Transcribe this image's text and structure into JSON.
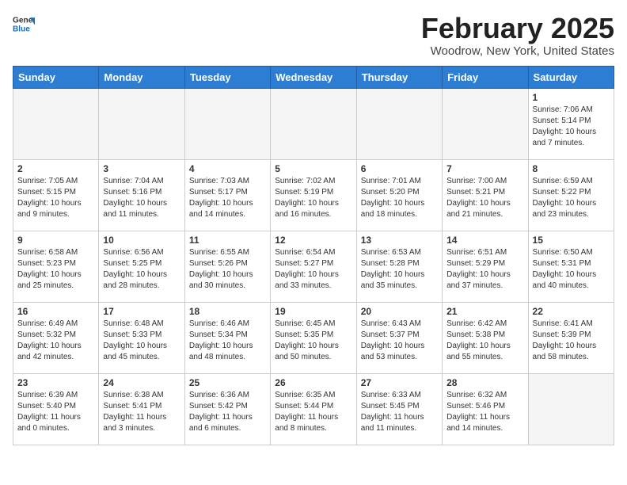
{
  "header": {
    "logo_general": "General",
    "logo_blue": "Blue",
    "title": "February 2025",
    "subtitle": "Woodrow, New York, United States"
  },
  "days_of_week": [
    "Sunday",
    "Monday",
    "Tuesday",
    "Wednesday",
    "Thursday",
    "Friday",
    "Saturday"
  ],
  "weeks": [
    [
      {
        "day": "",
        "empty": true
      },
      {
        "day": "",
        "empty": true
      },
      {
        "day": "",
        "empty": true
      },
      {
        "day": "",
        "empty": true
      },
      {
        "day": "",
        "empty": true
      },
      {
        "day": "",
        "empty": true
      },
      {
        "day": "1",
        "sunrise": "7:06 AM",
        "sunset": "5:14 PM",
        "daylight": "10 hours and 7 minutes."
      }
    ],
    [
      {
        "day": "2",
        "sunrise": "7:05 AM",
        "sunset": "5:15 PM",
        "daylight": "10 hours and 9 minutes."
      },
      {
        "day": "3",
        "sunrise": "7:04 AM",
        "sunset": "5:16 PM",
        "daylight": "10 hours and 11 minutes."
      },
      {
        "day": "4",
        "sunrise": "7:03 AM",
        "sunset": "5:17 PM",
        "daylight": "10 hours and 14 minutes."
      },
      {
        "day": "5",
        "sunrise": "7:02 AM",
        "sunset": "5:19 PM",
        "daylight": "10 hours and 16 minutes."
      },
      {
        "day": "6",
        "sunrise": "7:01 AM",
        "sunset": "5:20 PM",
        "daylight": "10 hours and 18 minutes."
      },
      {
        "day": "7",
        "sunrise": "7:00 AM",
        "sunset": "5:21 PM",
        "daylight": "10 hours and 21 minutes."
      },
      {
        "day": "8",
        "sunrise": "6:59 AM",
        "sunset": "5:22 PM",
        "daylight": "10 hours and 23 minutes."
      }
    ],
    [
      {
        "day": "9",
        "sunrise": "6:58 AM",
        "sunset": "5:23 PM",
        "daylight": "10 hours and 25 minutes."
      },
      {
        "day": "10",
        "sunrise": "6:56 AM",
        "sunset": "5:25 PM",
        "daylight": "10 hours and 28 minutes."
      },
      {
        "day": "11",
        "sunrise": "6:55 AM",
        "sunset": "5:26 PM",
        "daylight": "10 hours and 30 minutes."
      },
      {
        "day": "12",
        "sunrise": "6:54 AM",
        "sunset": "5:27 PM",
        "daylight": "10 hours and 33 minutes."
      },
      {
        "day": "13",
        "sunrise": "6:53 AM",
        "sunset": "5:28 PM",
        "daylight": "10 hours and 35 minutes."
      },
      {
        "day": "14",
        "sunrise": "6:51 AM",
        "sunset": "5:29 PM",
        "daylight": "10 hours and 37 minutes."
      },
      {
        "day": "15",
        "sunrise": "6:50 AM",
        "sunset": "5:31 PM",
        "daylight": "10 hours and 40 minutes."
      }
    ],
    [
      {
        "day": "16",
        "sunrise": "6:49 AM",
        "sunset": "5:32 PM",
        "daylight": "10 hours and 42 minutes."
      },
      {
        "day": "17",
        "sunrise": "6:48 AM",
        "sunset": "5:33 PM",
        "daylight": "10 hours and 45 minutes."
      },
      {
        "day": "18",
        "sunrise": "6:46 AM",
        "sunset": "5:34 PM",
        "daylight": "10 hours and 48 minutes."
      },
      {
        "day": "19",
        "sunrise": "6:45 AM",
        "sunset": "5:35 PM",
        "daylight": "10 hours and 50 minutes."
      },
      {
        "day": "20",
        "sunrise": "6:43 AM",
        "sunset": "5:37 PM",
        "daylight": "10 hours and 53 minutes."
      },
      {
        "day": "21",
        "sunrise": "6:42 AM",
        "sunset": "5:38 PM",
        "daylight": "10 hours and 55 minutes."
      },
      {
        "day": "22",
        "sunrise": "6:41 AM",
        "sunset": "5:39 PM",
        "daylight": "10 hours and 58 minutes."
      }
    ],
    [
      {
        "day": "23",
        "sunrise": "6:39 AM",
        "sunset": "5:40 PM",
        "daylight": "11 hours and 0 minutes."
      },
      {
        "day": "24",
        "sunrise": "6:38 AM",
        "sunset": "5:41 PM",
        "daylight": "11 hours and 3 minutes."
      },
      {
        "day": "25",
        "sunrise": "6:36 AM",
        "sunset": "5:42 PM",
        "daylight": "11 hours and 6 minutes."
      },
      {
        "day": "26",
        "sunrise": "6:35 AM",
        "sunset": "5:44 PM",
        "daylight": "11 hours and 8 minutes."
      },
      {
        "day": "27",
        "sunrise": "6:33 AM",
        "sunset": "5:45 PM",
        "daylight": "11 hours and 11 minutes."
      },
      {
        "day": "28",
        "sunrise": "6:32 AM",
        "sunset": "5:46 PM",
        "daylight": "11 hours and 14 minutes."
      },
      {
        "day": "",
        "empty": true
      }
    ]
  ],
  "labels": {
    "sunrise": "Sunrise:",
    "sunset": "Sunset:",
    "daylight": "Daylight:"
  }
}
